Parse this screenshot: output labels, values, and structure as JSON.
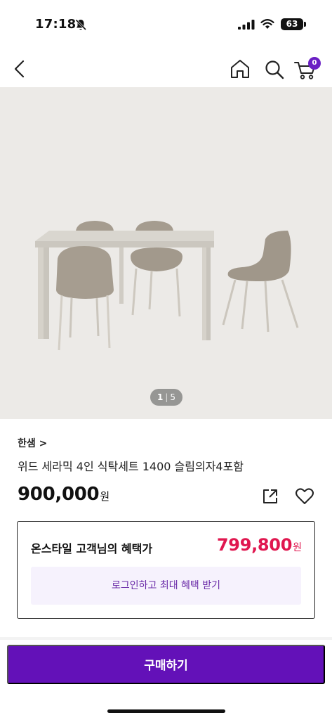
{
  "status_bar": {
    "time": "17:18",
    "battery": "63",
    "icons": [
      "bell-slash-icon",
      "signal-icon",
      "wifi-icon",
      "battery-icon"
    ]
  },
  "header": {
    "icons": [
      "back-icon",
      "home-icon",
      "search-icon",
      "cart-icon"
    ],
    "cart_count": "0"
  },
  "gallery": {
    "current": "1",
    "separator": "|",
    "total": "5"
  },
  "product": {
    "brand": "한샘 >",
    "name": "위드 세라믹 4인 식탁세트 1400 슬림의자4포함",
    "price": "900,000",
    "currency": "원",
    "actions": [
      "share-icon",
      "heart-icon"
    ]
  },
  "benefit": {
    "label": "온스타일 고객님의 혜택가",
    "price": "799,800",
    "currency": "원",
    "login_button": "로그인하고 최대 혜택 받기"
  },
  "buy_button": "구매하기",
  "colors": {
    "brand_purple": "#6311b8",
    "badge_purple": "#6a1fc4",
    "benefit_red": "#e0174f",
    "login_text": "#6a2ba8",
    "login_bg": "#f6f2fd",
    "image_bg": "#eceae7"
  }
}
